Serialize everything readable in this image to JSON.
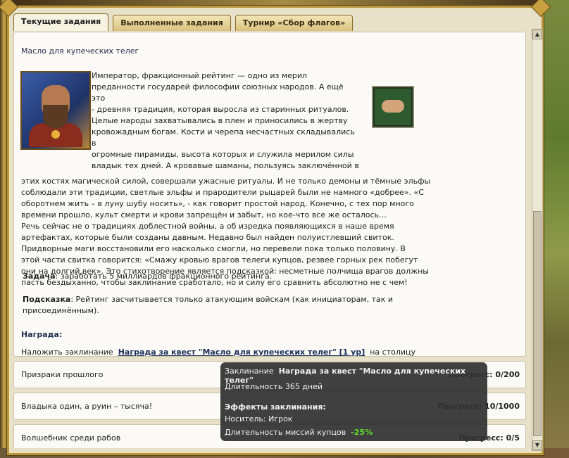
{
  "tabs": [
    {
      "label": "Текущие задания",
      "active": true
    },
    {
      "label": "Выполненные задания",
      "active": false
    },
    {
      "label": "Турнир «Сбор флагов»",
      "active": false
    }
  ],
  "quest": {
    "title": "Масло для купеческих телег",
    "story_lines": [
      "Император, фракционный рейтинг — одно из мерил",
      "преданности государей философии союзных народов. А ещё это",
      "- древняя традиция, которая выросла из старинных ритуалов.",
      "Целые народы захватывались в плен и приносились в жертву",
      "кровожадным богам. Кости и черепа несчастных складывались в",
      "огромные пирамиды, высота которых и служила мерилом силы",
      "владык тех дней. А кровавые шаманы, пользуясь заключённой в"
    ],
    "story_lines_full": [
      "этих костях магической силой, совершали ужасные ритуалы. И не только демоны и тёмные эльфы",
      "соблюдали эти традиции, светлые эльфы и прародители рыцарей были не намного «добрее». «С",
      "оборотнем жить – в луну шубу носить», - как говорит простой народ. Конечно, с тех пор много",
      "времени прошло, культ смерти и крови запрещён и забыт, но кое-что все же осталось…",
      " Речь сейчас не о традициях доблестной войны, а об изредка появляющихся в наше время",
      "артефактах, которые были созданы давным. Недавно был найден полуистлевший свиток.",
      "Придворные маги восстановили его насколько смогли, но перевели пока только половину. В",
      "этой части свитка говорится: «Смажу кровью врагов телеги купцов, резвее горных рек побегут",
      "они на долгий век». Это стихотворение является подсказкой: несметные полчища врагов должны",
      "пасть бездыханно, чтобы заклинание сработало, но и силу его сравнить абсолютно не с чем!"
    ],
    "task_label": "Задача",
    "task_text": ": заработать 5 миллиардов фракционного рейтинга.",
    "hint_label": "Подсказка",
    "hint_text": ": Рейтинг засчитывается только атакующим войскам (как инициаторам, так и присоединённым).",
    "reward_heading": "Награда:",
    "reward_prefix": "Наложить заклинание",
    "reward_link": "Награда за квест \"Масло для купеческих телег\" [1 ур]",
    "reward_suffix": "на столицу"
  },
  "other_quests": [
    {
      "name": "Призраки прошлого",
      "progress": "Прогресс: 0/200"
    },
    {
      "name": "Владыка один, а руин – тысяча!",
      "progress": "Прогресс: 10/1000"
    },
    {
      "name": "Волшебник среди рабов",
      "progress": "Прогресс: 0/5"
    }
  ],
  "tooltip": {
    "spell_label": "Заклинание",
    "spell_name": "Награда за квест \"Масло для купеческих телег\"",
    "duration": "Длительность 365 дней",
    "effects_heading": "Эффекты заклинания:",
    "carrier": "Носитель: Игрок",
    "effect_label": "Длительность миссий купцов",
    "effect_value": "-25%"
  },
  "icons": {
    "portrait": "hero-portrait-icon",
    "handshake": "handshake-icon"
  }
}
